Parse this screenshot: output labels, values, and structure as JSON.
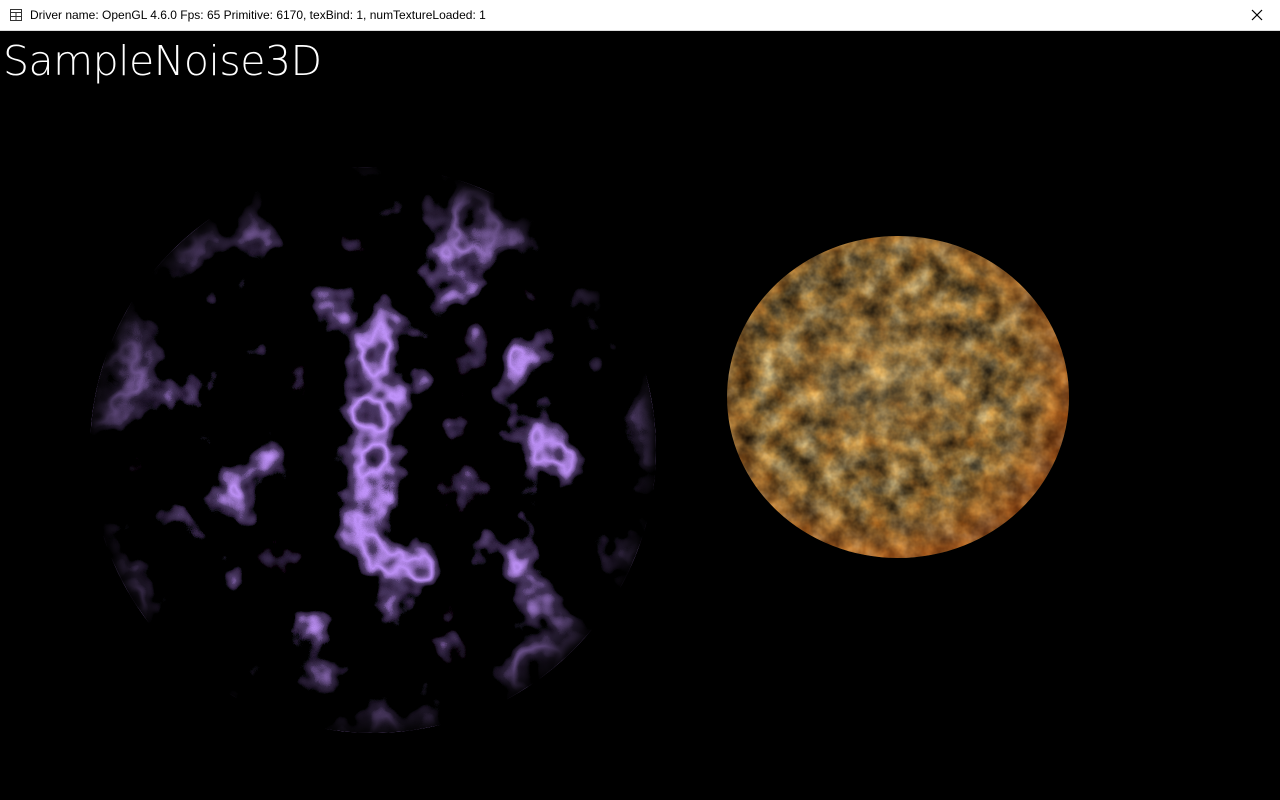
{
  "window": {
    "title": "Driver name: OpenGL 4.6.0 Fps: 65 Primitive: 6170, texBind: 1, numTextureLoaded: 1",
    "app_icon": "app-window-icon",
    "close_icon": "close-icon"
  },
  "viewport": {
    "heading": "SampleNoise3D",
    "background_color": "#000000",
    "objects": [
      {
        "name": "purple-noise-sphere",
        "style": "electric veins",
        "color": "#8a4dff"
      },
      {
        "name": "orange-fire-sphere",
        "style": "fire noise",
        "color": "#ff8a1c"
      }
    ]
  }
}
